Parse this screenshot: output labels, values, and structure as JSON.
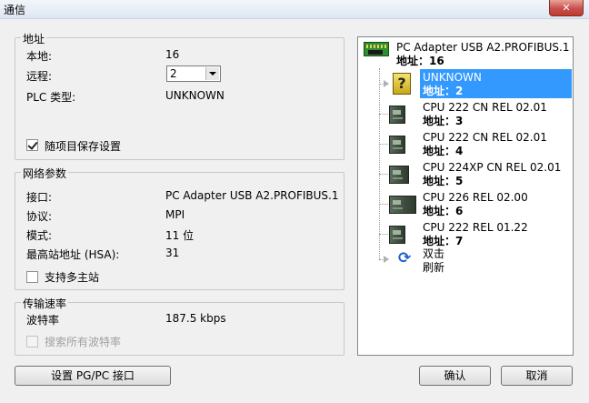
{
  "window": {
    "title": "通信",
    "close_icon": "close-icon"
  },
  "address_group": {
    "title": "地址",
    "local_label": "本地:",
    "local_value": "16",
    "remote_label": "远程:",
    "remote_value": "2",
    "plc_type_label": "PLC 类型:",
    "plc_type_value": "UNKNOWN",
    "save_settings_label": "随项目保存设置",
    "save_settings_checked": true
  },
  "network_group": {
    "title": "网络参数",
    "interface_label": "接口:",
    "interface_value": "PC Adapter USB A2.PROFIBUS.1",
    "protocol_label": "协议:",
    "protocol_value": "MPI",
    "mode_label": "模式:",
    "mode_value": "11 位",
    "hsa_label": "最高站地址 (HSA):",
    "hsa_value": "31",
    "multi_master_label": "支持多主站",
    "multi_master_checked": false
  },
  "baud_group": {
    "title": "传输速率",
    "baud_label": "波特率",
    "baud_value": "187.5 kbps",
    "search_all_label": "搜索所有波特率",
    "search_all_checked": false,
    "search_all_enabled": false
  },
  "tree": {
    "adapter": {
      "name": "PC Adapter USB A2.PROFIBUS.1",
      "address": "地址：16"
    },
    "nodes": [
      {
        "name": "UNKNOWN",
        "address": "地址：2",
        "selected": true,
        "icon": "unknown-device-icon"
      },
      {
        "name": "CPU 222 CN REL 02.01",
        "address": "地址：3",
        "icon": "plc-cpu-icon"
      },
      {
        "name": "CPU 222 CN REL 02.01",
        "address": "地址：4",
        "icon": "plc-cpu-icon"
      },
      {
        "name": "CPU 224XP CN REL 02.01",
        "address": "地址：5",
        "icon": "plc-cpu-icon"
      },
      {
        "name": "CPU 226 REL 02.00",
        "address": "地址：6",
        "icon": "plc-cpu-icon"
      },
      {
        "name": "CPU 222 REL 01.22",
        "address": "地址：7",
        "icon": "plc-cpu-icon"
      }
    ],
    "refresh": {
      "line1": "双击",
      "line2": "刷新",
      "icon": "refresh-icon"
    }
  },
  "buttons": {
    "set_pgpc": "设置 PG/PC 接口",
    "ok": "确认",
    "cancel": "取消"
  },
  "colors": {
    "selection": "#3399ff",
    "background": "#f0f0f0"
  }
}
